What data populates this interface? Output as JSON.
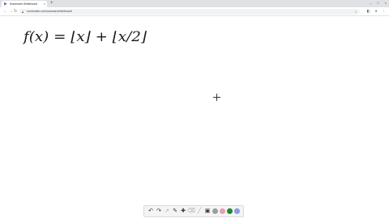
{
  "browser": {
    "tab_title": "Numerade Whiteboard",
    "tab_close": "×",
    "new_tab": "+",
    "url": "numerade.com/canvas/whiteboard/",
    "window_controls": [
      "–",
      "□",
      "×"
    ]
  },
  "whiteboard": {
    "expression": "f(x) = ⌊x⌋ + ⌊x/2⌋"
  },
  "draw_toolbar": {
    "tools": [
      "undo-icon",
      "redo-icon",
      "pointer-icon",
      "pen-icon",
      "add-icon",
      "eraser-icon",
      "highlighter-icon",
      "image-icon",
      "shape-icon"
    ],
    "colors": [
      "#9e9e9e",
      "#e8a0b4",
      "#1a8a2e",
      "#8c9ae0"
    ]
  }
}
